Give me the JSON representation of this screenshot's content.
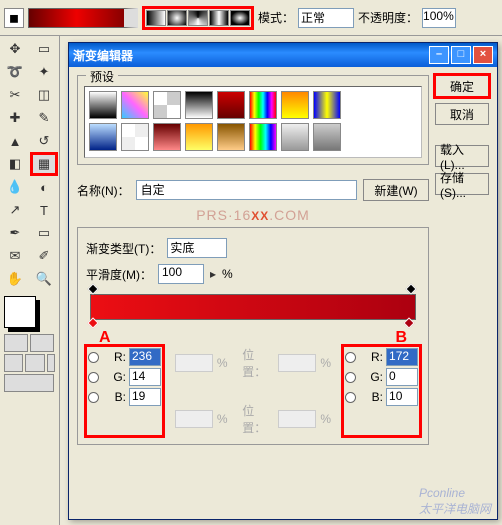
{
  "topbar": {
    "mode_label": "模式：",
    "mode_value": "正常",
    "opacity_label": "不透明度：",
    "opacity_value": "100"
  },
  "dialog": {
    "title": "渐变编辑器",
    "buttons": {
      "ok": "确定",
      "cancel": "取消",
      "load": "载入(L)...",
      "save": "存储(S)...",
      "new": "新建(W)"
    },
    "preset_label": "预设",
    "name_label": "名称(N)：",
    "name_value": "自定",
    "grad_type_label": "渐变类型(T)：",
    "grad_type_value": "实底",
    "smooth_label": "平滑度(M)：",
    "smooth_value": "100",
    "percent": "%",
    "pos_label": "位置：",
    "stop_a": "A",
    "stop_b": "B",
    "rgb_a": {
      "r": "236",
      "g": "14",
      "b": "19"
    },
    "rgb_b": {
      "r": "172",
      "g": "0",
      "b": "10"
    }
  },
  "watermark": {
    "line1": "Pconline",
    "line2": "太平洋电脑网"
  },
  "presets": [
    "linear-gradient(to bottom,#fff,#000)",
    "linear-gradient(45deg,#3cf,#f6f,#ff3)",
    "repeating-conic-gradient(#ccc 0 25%,#fff 0 50%)",
    "linear-gradient(to bottom,#000,#fff)",
    "linear-gradient(to bottom,#c00,#600)",
    "linear-gradient(to right,#f00,#ff0,#0f0,#0ff,#00f,#f0f,#f00)",
    "linear-gradient(to bottom,#f80,#ff0)",
    "linear-gradient(to right,#00f,#ff0,#00f)",
    "linear-gradient(to bottom,#bdf,#028)",
    "repeating-conic-gradient(#eee 0 25%,#fff 0 50%)",
    "linear-gradient(to bottom,#600,#f88)",
    "linear-gradient(to bottom,#f90,#ff6)",
    "linear-gradient(to bottom,#850,#fc8)",
    "linear-gradient(to right,#f00,#ff0,#0f0,#0ff,#00f,#f0f)",
    "linear-gradient(to bottom,#eee,#999)",
    "linear-gradient(to bottom,#ccc,#777)"
  ]
}
